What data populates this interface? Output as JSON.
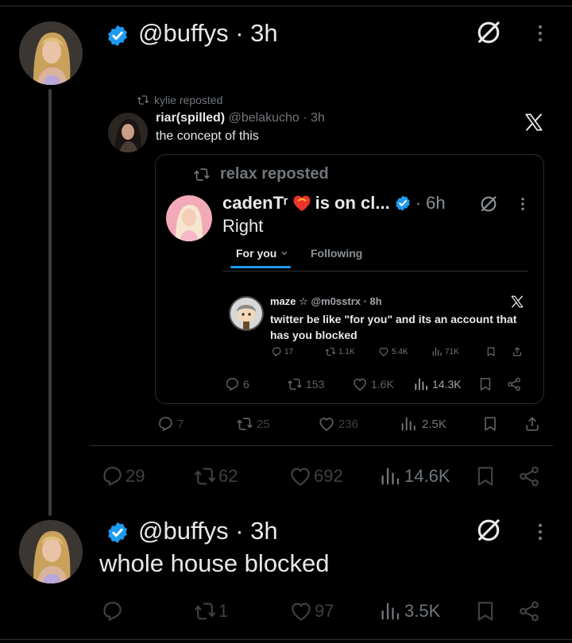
{
  "post1": {
    "handle": "@buffys",
    "time": "· 3h",
    "stats": {
      "replies": "29",
      "reposts": "62",
      "likes": "692",
      "views": "14.6K"
    }
  },
  "quote": {
    "repost_label": "kylie reposted",
    "name": "riar(spilled)",
    "handle": "@belakucho",
    "time": "· 3h",
    "text": "the concept of this",
    "stats": {
      "replies": "7",
      "reposts": "25",
      "likes": "236",
      "views": "2.5K"
    }
  },
  "screenshot_card": {
    "repost_label": "relax reposted",
    "name": "cadenTʳ",
    "name_suffix": "is on cl...",
    "time": "· 6h",
    "text": "Right",
    "tabs": [
      {
        "label": "For you"
      },
      {
        "label": "Following"
      }
    ],
    "stats": {
      "replies": "6",
      "reposts": "153",
      "likes": "1.6K",
      "views": "14.3K"
    }
  },
  "nested": {
    "name": "maze",
    "star": "☆",
    "handle": "@m0sstrx",
    "time": "· 8h",
    "text": "twitter be like \"for you\" and its an account that has you blocked",
    "stats": {
      "replies": "17",
      "reposts": "1.1K",
      "likes": "5.4K",
      "views": "71K"
    }
  },
  "post2": {
    "handle": "@buffys",
    "time": "· 3h",
    "text": "whole house blocked",
    "stats": {
      "replies": "",
      "reposts": "1",
      "likes": "97",
      "views": "3.5K"
    }
  },
  "colors": {
    "accent": "#1d9bf0",
    "text": "#e7e9ea",
    "muted": "#71767b",
    "background": "#000000"
  },
  "icons": [
    "verified-icon",
    "grok-icon",
    "more-icon",
    "x-logo-icon",
    "repost-icon",
    "reply-icon",
    "like-icon",
    "views-icon",
    "bookmark-icon",
    "share-icon",
    "heart-emoji-icon",
    "chevron-down-icon"
  ]
}
